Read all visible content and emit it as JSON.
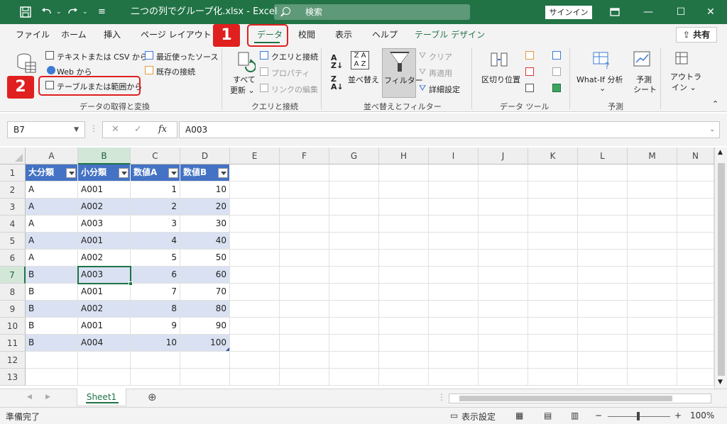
{
  "window": {
    "title": "二つの列でグループ化.xlsx - Excel",
    "search_placeholder": "検索",
    "signin_label": "サインイン",
    "minimize": "—",
    "maximize": "☐",
    "close": "✕"
  },
  "menu": {
    "tabs": [
      "ファイル",
      "ホーム",
      "挿入",
      "ページ レイアウト",
      "データ",
      "校閲",
      "表示",
      "ヘルプ",
      "テーブル デザイン"
    ],
    "active_tab": "データ",
    "share_label": "共有"
  },
  "ribbon": {
    "get_transform": {
      "text_csv": "テキストまたは CSV から",
      "web": "Web から",
      "table_range": "テーブルまたは範囲から",
      "recent_sources": "最近使ったソース",
      "existing_connections": "既存の接続",
      "group_label": "データの取得と変換"
    },
    "queries": {
      "refresh_all_line1": "すべて",
      "refresh_all_line2": "更新 ⌄",
      "queries_connections": "クエリと接続",
      "properties": "プロパティ",
      "edit_links": "リンクの編集",
      "group_label": "クエリと接続"
    },
    "sort_filter": {
      "sort": "並べ替え",
      "filter": "フィルター",
      "clear": "クリア",
      "reapply": "再適用",
      "advanced": "詳細設定",
      "group_label": "並べ替えとフィルター"
    },
    "data_tools": {
      "text_to_columns": "区切り位置",
      "group_label": "データ ツール"
    },
    "forecast": {
      "whatif": "What-If 分析",
      "whatif_dd": "⌄",
      "forecast_sheet_line1": "予測",
      "forecast_sheet_line2": "シート",
      "group_label": "予測"
    },
    "outline": {
      "label_line1": "アウトラ",
      "label_line2": "イン ⌄"
    },
    "collapse": "⌃"
  },
  "callouts": [
    "1",
    "2"
  ],
  "formula_bar": {
    "name_box": "B7",
    "cancel": "✕",
    "enter": "✓",
    "fx": "fx",
    "value": "A003"
  },
  "grid": {
    "columns": [
      "A",
      "B",
      "C",
      "D",
      "E",
      "F",
      "G",
      "H",
      "I",
      "J",
      "K",
      "L",
      "M",
      "N"
    ],
    "rows": [
      "1",
      "2",
      "3",
      "4",
      "5",
      "6",
      "7",
      "8",
      "9",
      "10",
      "11",
      "12",
      "13"
    ],
    "table_headers": [
      "大分類",
      "小分類",
      "数値A",
      "数値B"
    ],
    "table_rows": [
      [
        "A",
        "A001",
        "1",
        "10"
      ],
      [
        "A",
        "A002",
        "2",
        "20"
      ],
      [
        "A",
        "A003",
        "3",
        "30"
      ],
      [
        "A",
        "A001",
        "4",
        "40"
      ],
      [
        "A",
        "A002",
        "5",
        "50"
      ],
      [
        "B",
        "A003",
        "6",
        "60"
      ],
      [
        "B",
        "A001",
        "7",
        "70"
      ],
      [
        "B",
        "A002",
        "8",
        "80"
      ],
      [
        "B",
        "A001",
        "9",
        "90"
      ],
      [
        "B",
        "A004",
        "10",
        "100"
      ]
    ]
  },
  "sheets": {
    "tabs": [
      "Sheet1"
    ],
    "add": "⊕",
    "nav_prev": "◀",
    "nav_next": "▶"
  },
  "status": {
    "ready": "準備完了",
    "display_settings": "表示設定",
    "zoom_minus": "−",
    "zoom_plus": "+",
    "zoom": "100%"
  },
  "colors": {
    "excel_green": "#217346",
    "table_header": "#4472c4",
    "table_band": "#d9e1f2",
    "callout_red": "#e0201f"
  }
}
